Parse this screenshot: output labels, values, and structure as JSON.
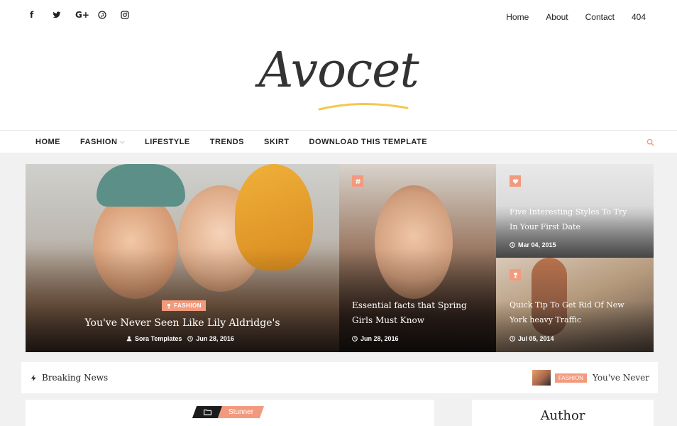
{
  "social": [
    {
      "icon": "facebook-icon",
      "glyph": "f"
    },
    {
      "icon": "twitter-icon",
      "glyph": ""
    },
    {
      "icon": "google-plus-icon",
      "glyph": "G+"
    },
    {
      "icon": "pinterest-icon",
      "glyph": ""
    },
    {
      "icon": "instagram-icon",
      "glyph": ""
    }
  ],
  "top_menu": [
    "Home",
    "About",
    "Contact",
    "404"
  ],
  "logo": {
    "text": "Avocet",
    "underline_color": "#f5c74e"
  },
  "nav": {
    "items": [
      "HOME",
      "FASHION",
      "LIFESTYLE",
      "TRENDS",
      "SKIRT",
      "DOWNLOAD THIS TEMPLATE"
    ],
    "dropdown_indicator": "⌵"
  },
  "colors": {
    "accent": "#f29a7e",
    "dark": "#1c1c1c"
  },
  "slider": {
    "main": {
      "category": "FASHION",
      "title": "You've Never Seen Like Lily Aldridge's",
      "author": "Sora Templates",
      "date": "Jun 28, 2016"
    },
    "middle": {
      "category_icon": "hash-icon",
      "title": "Essential facts that Spring Girls Must Know",
      "date": "Jun 28, 2016"
    },
    "top_right": {
      "category_icon": "heart-icon",
      "title": "Five Interesting Styles To Try In Your First Date",
      "date": "Mar 04, 2015"
    },
    "bottom_right": {
      "category_icon": "trophy-icon",
      "title": "Quick Tip To Get Rid Of New York heavy Traffic",
      "date": "Jul 05, 2014"
    }
  },
  "breaking": {
    "label": "Breaking News",
    "ticker_badge": "FASHION",
    "ticker_text": "You've Never"
  },
  "post": {
    "tag": "Stunner"
  },
  "sidebar": {
    "title": "Author"
  }
}
